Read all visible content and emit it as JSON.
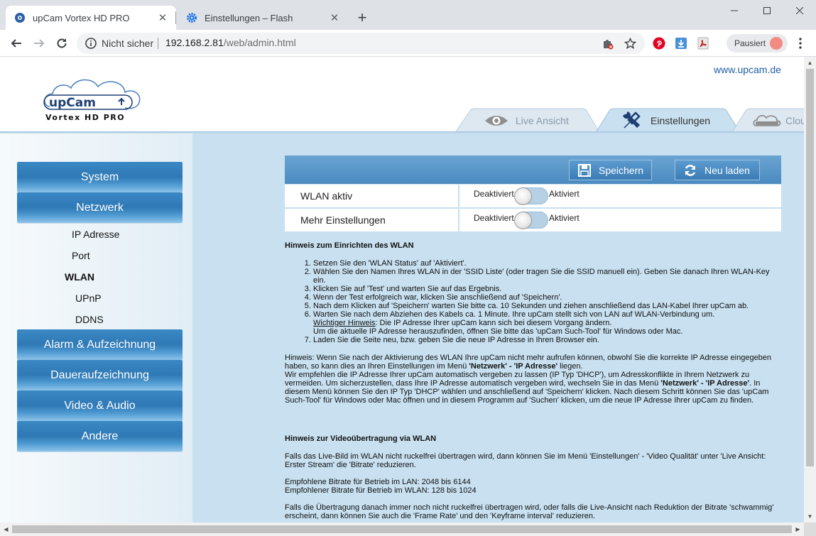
{
  "browser": {
    "tabs": [
      {
        "title": "upCam Vortex HD PRO",
        "active": true
      },
      {
        "title": "Einstellungen – Flash",
        "active": false
      }
    ],
    "security_label": "Nicht sicher",
    "url_host": "192.168.2.81",
    "url_path": "/web/admin.html",
    "profile_label": "Pausiert",
    "accent_color": "#1a73e8"
  },
  "page": {
    "brand_link": "www.upcam.de",
    "logo_text": "upCam",
    "logo_sub": "Vortex HD PRO",
    "tabs": [
      {
        "label": "Live Ansicht",
        "active": false
      },
      {
        "label": "Einstellungen",
        "active": true
      },
      {
        "label": "Clou",
        "active": false
      }
    ],
    "menu": [
      {
        "label": "System"
      },
      {
        "label": "Netzwerk"
      },
      {
        "label": "Alarm & Aufzeichnung"
      },
      {
        "label": "Daueraufzeichnung"
      },
      {
        "label": "Video & Audio"
      },
      {
        "label": "Andere"
      }
    ],
    "submenu": [
      "IP Adresse",
      "Port",
      "WLAN",
      "UPnP",
      "DDNS"
    ],
    "active_submenu": "WLAN",
    "buttons": {
      "save": "Speichern",
      "reload": "Neu laden"
    },
    "settings": [
      {
        "label": "WLAN aktiv",
        "off": "Deaktiviert",
        "on": "Aktiviert",
        "enabled": false
      },
      {
        "label": "Mehr Einstellungen",
        "off": "Deaktiviert",
        "on": "Aktiviert",
        "enabled": false
      }
    ],
    "setup": {
      "heading": "Hinweis zum Einrichten des WLAN",
      "steps": [
        "Setzen Sie den 'WLAN Status' auf 'Aktiviert'.",
        "Wählen Sie den Namen Ihres WLAN in der 'SSID Liste' (oder tragen Sie die SSID manuell ein). Geben Sie danach Ihren WLAN-Key ein.",
        "Klicken Sie auf 'Test' und warten Sie auf das Ergebnis.",
        "Wenn der Test erfolgreich war, klicken Sie anschließend auf 'Speichern'.",
        "Nach dem Klicken auf 'Speichern' warten Sie bitte ca. 10 Sekunden und ziehen anschließend das LAN-Kabel Ihrer upCam ab.",
        "Warten Sie nach dem Abziehen des Kabels ca. 1 Minute. Ihre upCam stellt sich von LAN auf WLAN-Verbindung um.",
        "Laden Sie die Seite neu, bzw. geben Sie die neue IP Adresse in Ihren Browser ein."
      ],
      "note_label": "Wichtiger Hinweis",
      "note_text": ": Die IP Adresse Ihrer upCam kann sich bei diesem Vorgang ändern.",
      "note_text2": "Um die aktuelle IP Adresse herauszufinden, öffnen Sie bitte das 'upCam Such-Tool' für Windows oder Mac.",
      "hint_a": "Hinweis: Wenn Sie nach der Aktivierung des WLAN Ihre upCam nicht mehr aufrufen können, obwohl Sie die korrekte IP Adresse eingegeben haben, so kann dies an Ihren Einstellungen im Menü ",
      "hint_a_bold": "'Netzwerk' - 'IP Adresse'",
      "hint_a_end": " liegen.",
      "hint_b": "Wir empfehlen die IP Adresse Ihrer upCam automatisch vergeben zu lassen (IP Typ 'DHCP'), um Adresskonflikte in Ihrem Netzwerk zu vermeiden. Um sicherzustellen, dass Ihre IP Adresse automatisch vergeben wird, wechseln Sie in das Menü ",
      "hint_b_bold": "'Netzwerk' - 'IP Adresse'",
      "hint_b_end": ". In diesem Menü können Sie den IP Typ 'DHCP' wählen und anschließend auf 'Speichern' klicken. Nach diesem Schritt können Sie das 'upCam Such-Tool' für Windows oder Mac öffnen und in diesem Programm auf 'Suchen' klicken, um die neue IP Adresse Ihrer upCam zu finden."
    },
    "video": {
      "heading": "Hinweis zur Videoübertragung via WLAN",
      "p1": "Falls das Live-Bild im WLAN nicht ruckelfrei übertragen wird, dann können Sie im Menü 'Einstellungen' - 'Video Qualität' unter 'Live Ansicht: Erster Stream' die 'Bitrate' reduzieren.",
      "lan": "Empfohlene Bitrate für Betrieb im LAN: 2048 bis 6144",
      "wlan": "Empfohlener Bitrate für Betrieb im WLAN: 128 bis 1024",
      "p2": "Falls die Übertragung danach immer noch nicht ruckelfrei übertragen wird, oder falls die Live-Ansicht nach Reduktion der Bitrate 'schwammig' erscheint, dann können Sie auch die 'Frame Rate' und den 'Keyframe interval' reduzieren."
    }
  }
}
